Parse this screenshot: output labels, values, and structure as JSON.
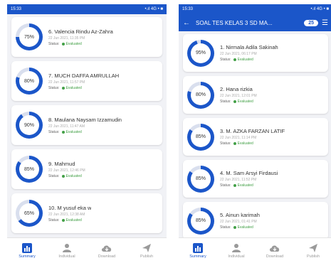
{
  "left_screen": {
    "statusbar": {
      "time": "15:33",
      "signal": "•.ıl 4G • ■"
    },
    "items": [
      {
        "percent": "75%",
        "value": 75,
        "name": "6. Valencia Rindu Az-Zahra",
        "date": "22 Jun 2021, 11:35 PM",
        "status_label": "Status:",
        "status": "Evaluated"
      },
      {
        "percent": "80%",
        "value": 80,
        "name": "7. MUCH DAFFA AMRULLAH",
        "date": "22 Jun 2021, 11:57 PM",
        "status_label": "Status:",
        "status": "Evaluated"
      },
      {
        "percent": "90%",
        "value": 90,
        "name": "8. Maulana Naysam Izzamudin",
        "date": "22 Jun 2021, 11:47 AM",
        "status_label": "Status:",
        "status": "Evaluated"
      },
      {
        "percent": "85%",
        "value": 85,
        "name": "9. Mahmud",
        "date": "22 Jun 2021, 12:46 PM",
        "status_label": "Status:",
        "status": "Evaluated"
      },
      {
        "percent": "65%",
        "value": 65,
        "name": "10. M yusuf eka w",
        "date": "22 Jun 2021, 12:38 AM",
        "status_label": "Status:",
        "status": "Evaluated"
      }
    ]
  },
  "right_screen": {
    "statusbar": {
      "time": "15:33",
      "signal": "•.ıl 4G • ■"
    },
    "appbar": {
      "title": "SOAL TES KELAS 3 SD MA...",
      "count": "25"
    },
    "items": [
      {
        "percent": "95%",
        "value": 95,
        "name": "1. Nirmala Adila Sakinah",
        "date": "22 Jun 2021, 06:17 PM",
        "status_label": "Status:",
        "status": "Evaluated"
      },
      {
        "percent": "80%",
        "value": 80,
        "name": "2. Hana rizkia",
        "date": "22 Jun 2021, 12:01 PM",
        "status_label": "Status:",
        "status": "Evaluated"
      },
      {
        "percent": "85%",
        "value": 85,
        "name": "3. M. AZKA FARZAN LATIF",
        "date": "22 Jun 2021, 11:14 PM",
        "status_label": "Status:",
        "status": "Evaluated"
      },
      {
        "percent": "85%",
        "value": 85,
        "name": "4. M. Sam Arsyi Firdausi",
        "date": "22 Jun 2021, 11:52 PM",
        "status_label": "Status:",
        "status": "Evaluated"
      },
      {
        "percent": "85%",
        "value": 85,
        "name": "5. Ainun karimah",
        "date": "22 Jun 2021, 01:41 PM",
        "status_label": "Status:",
        "status": "Evaluated"
      }
    ]
  },
  "bottom_nav": [
    {
      "label": "Summary",
      "icon": "bar-chart-icon",
      "active": true
    },
    {
      "label": "Individual",
      "icon": "person-icon",
      "active": false
    },
    {
      "label": "Download",
      "icon": "cloud-download-icon",
      "active": false
    },
    {
      "label": "Publish",
      "icon": "send-icon",
      "active": false
    }
  ],
  "colors": {
    "primary": "#1b56c9",
    "track": "#d9dfee",
    "evaluated": "#43a047"
  }
}
